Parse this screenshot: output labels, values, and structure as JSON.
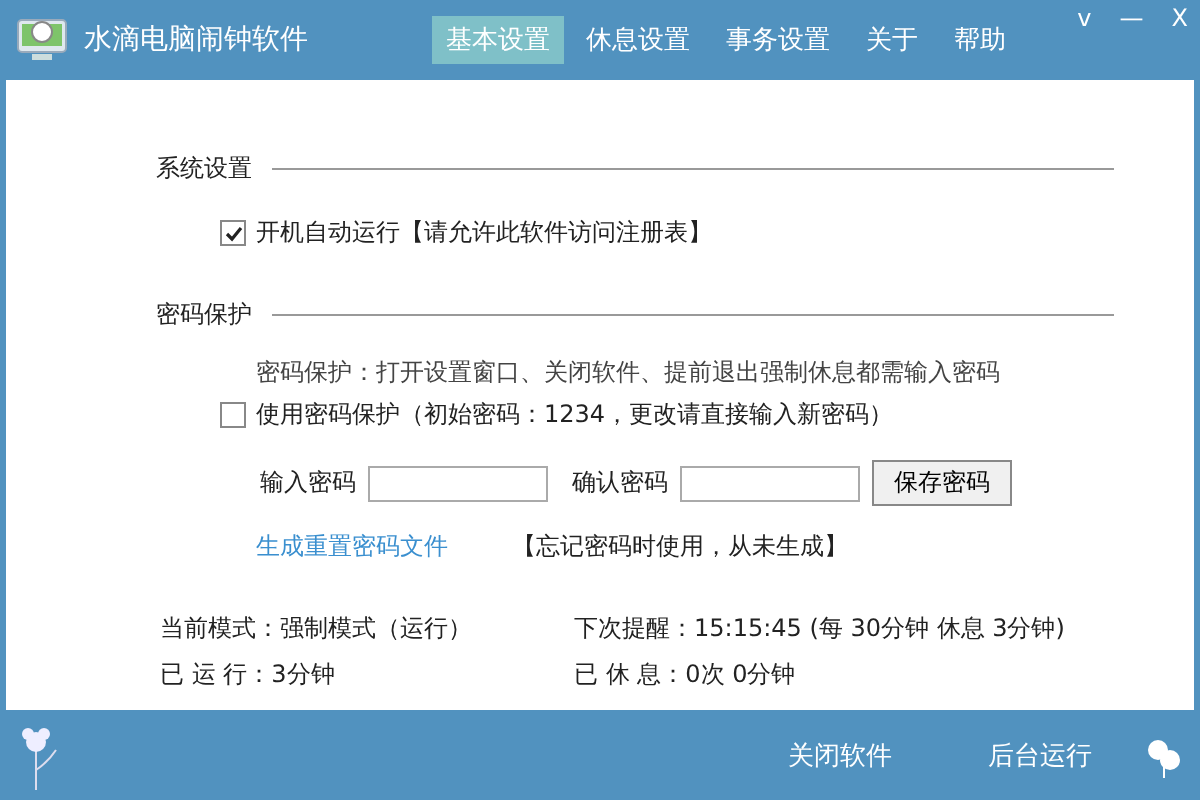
{
  "window": {
    "title": "水滴电脑闹钟软件",
    "controls": [
      "v",
      "—",
      "X"
    ]
  },
  "tabs": [
    {
      "label": "基本设置",
      "selected": true
    },
    {
      "label": "休息设置",
      "selected": false
    },
    {
      "label": "事务设置",
      "selected": false
    },
    {
      "label": "关于",
      "selected": false
    },
    {
      "label": "帮助",
      "selected": false
    }
  ],
  "system_settings": {
    "heading": "系统设置",
    "autostart": {
      "label": "开机自动运行【请允许此软件访问注册表】",
      "checked": true
    }
  },
  "password_protection": {
    "heading": "密码保护",
    "description": "密码保护：打开设置窗口、关闭软件、提前退出强制休息都需输入密码",
    "use_password": {
      "label": "使用密码保护（初始密码：1234，更改请直接输入新密码）",
      "checked": false
    },
    "enter_label": "输入密码",
    "confirm_label": "确认密码",
    "save_button": "保存密码",
    "reset_link": "生成重置密码文件",
    "reset_note": "【忘记密码时使用，从未生成】"
  },
  "status": [
    {
      "text": "当前模式：强制模式（运行）"
    },
    {
      "text": "下次提醒：15:15:45 (每 30分钟 休息 3分钟)"
    },
    {
      "text": "已 运 行：3分钟"
    },
    {
      "text": "已 休 息：0次  0分钟"
    }
  ],
  "footer_buttons": [
    "关闭软件",
    "后台运行"
  ]
}
